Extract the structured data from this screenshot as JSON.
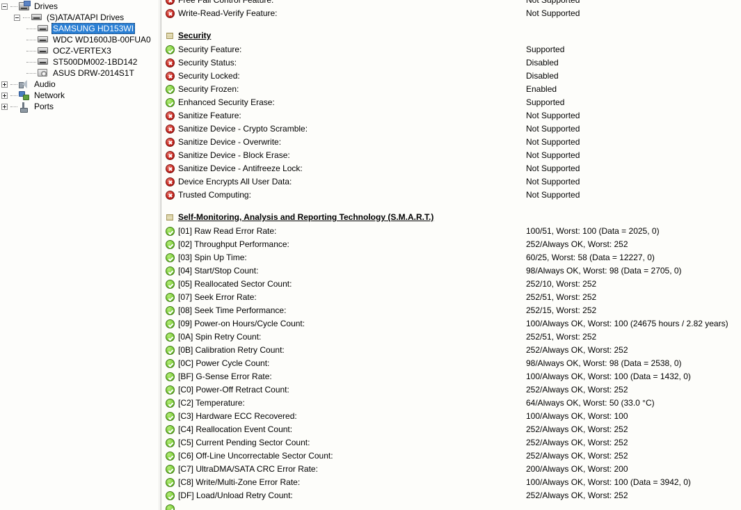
{
  "tree": {
    "nodes": [
      {
        "label": "Drives",
        "icon": "drives-icon",
        "indent": 0,
        "expander": "minus",
        "selected": false
      },
      {
        "label": "(S)ATA/ATAPI Drives",
        "icon": "hdd-icon",
        "indent": 1,
        "expander": "minus",
        "selected": false
      },
      {
        "label": "SAMSUNG HD153WI",
        "icon": "hdd-icon",
        "indent": 2,
        "expander": "none",
        "selected": true
      },
      {
        "label": "WDC WD1600JB-00FUA0",
        "icon": "hdd-icon",
        "indent": 2,
        "expander": "none",
        "selected": false
      },
      {
        "label": "OCZ-VERTEX3",
        "icon": "hdd-icon",
        "indent": 2,
        "expander": "none",
        "selected": false
      },
      {
        "label": "ST500DM002-1BD142",
        "icon": "hdd-icon",
        "indent": 2,
        "expander": "none",
        "selected": false
      },
      {
        "label": "ASUS DRW-2014S1T",
        "icon": "optical-drive-icon",
        "indent": 2,
        "expander": "none",
        "selected": false
      },
      {
        "label": "Audio",
        "icon": "audio-icon",
        "indent": 0,
        "expander": "plus",
        "selected": false
      },
      {
        "label": "Network",
        "icon": "network-icon",
        "indent": 0,
        "expander": "plus",
        "selected": false
      },
      {
        "label": "Ports",
        "icon": "ports-icon",
        "indent": 0,
        "expander": "plus",
        "selected": false
      }
    ]
  },
  "detail": {
    "rows": [
      {
        "kind": "item",
        "status": "bad",
        "label": "Free Fall Control Feature:",
        "value": "Not Supported"
      },
      {
        "kind": "item",
        "status": "bad",
        "label": "Write-Read-Verify Feature:",
        "value": "Not Supported"
      },
      {
        "kind": "spacer"
      },
      {
        "kind": "section",
        "label": "Security"
      },
      {
        "kind": "item",
        "status": "ok",
        "label": "Security Feature:",
        "value": "Supported"
      },
      {
        "kind": "item",
        "status": "bad",
        "label": "Security Status:",
        "value": "Disabled"
      },
      {
        "kind": "item",
        "status": "bad",
        "label": "Security Locked:",
        "value": "Disabled"
      },
      {
        "kind": "item",
        "status": "ok",
        "label": "Security Frozen:",
        "value": "Enabled"
      },
      {
        "kind": "item",
        "status": "ok",
        "label": "Enhanced Security Erase:",
        "value": "Supported"
      },
      {
        "kind": "item",
        "status": "bad",
        "label": "Sanitize Feature:",
        "value": "Not Supported"
      },
      {
        "kind": "item",
        "status": "bad",
        "label": "Sanitize Device - Crypto Scramble:",
        "value": "Not Supported"
      },
      {
        "kind": "item",
        "status": "bad",
        "label": "Sanitize Device - Overwrite:",
        "value": "Not Supported"
      },
      {
        "kind": "item",
        "status": "bad",
        "label": "Sanitize Device - Block Erase:",
        "value": "Not Supported"
      },
      {
        "kind": "item",
        "status": "bad",
        "label": "Sanitize Device - Antifreeze Lock:",
        "value": "Not Supported"
      },
      {
        "kind": "item",
        "status": "bad",
        "label": "Device Encrypts All User Data:",
        "value": "Not Supported"
      },
      {
        "kind": "item",
        "status": "bad",
        "label": "Trusted Computing:",
        "value": "Not Supported"
      },
      {
        "kind": "spacer"
      },
      {
        "kind": "section",
        "label": "Self-Monitoring, Analysis and Reporting Technology (S.M.A.R.T.)"
      },
      {
        "kind": "item",
        "status": "ok",
        "label": "[01] Raw Read Error Rate:",
        "value": "100/51, Worst: 100 (Data = 2025, 0)"
      },
      {
        "kind": "item",
        "status": "ok",
        "label": "[02] Throughput Performance:",
        "value": "252/Always OK, Worst: 252"
      },
      {
        "kind": "item",
        "status": "ok",
        "label": "[03] Spin Up Time:",
        "value": "60/25, Worst: 58 (Data = 12227, 0)"
      },
      {
        "kind": "item",
        "status": "ok",
        "label": "[04] Start/Stop Count:",
        "value": "98/Always OK, Worst: 98 (Data = 2705, 0)"
      },
      {
        "kind": "item",
        "status": "ok",
        "label": "[05] Reallocated Sector Count:",
        "value": "252/10, Worst: 252"
      },
      {
        "kind": "item",
        "status": "ok",
        "label": "[07] Seek Error Rate:",
        "value": "252/51, Worst: 252"
      },
      {
        "kind": "item",
        "status": "ok",
        "label": "[08] Seek Time Performance:",
        "value": "252/15, Worst: 252"
      },
      {
        "kind": "item",
        "status": "ok",
        "label": "[09] Power-on Hours/Cycle Count:",
        "value": "100/Always OK, Worst: 100 (24675 hours / 2.82 years)"
      },
      {
        "kind": "item",
        "status": "ok",
        "label": "[0A] Spin Retry Count:",
        "value": "252/51, Worst: 252"
      },
      {
        "kind": "item",
        "status": "ok",
        "label": "[0B] Calibration Retry Count:",
        "value": "252/Always OK, Worst: 252"
      },
      {
        "kind": "item",
        "status": "ok",
        "label": "[0C] Power Cycle Count:",
        "value": "98/Always OK, Worst: 98 (Data = 2538, 0)"
      },
      {
        "kind": "item",
        "status": "ok",
        "label": "[BF] G-Sense Error Rate:",
        "value": "100/Always OK, Worst: 100 (Data = 1432, 0)"
      },
      {
        "kind": "item",
        "status": "ok",
        "label": "[C0] Power-Off Retract Count:",
        "value": "252/Always OK, Worst: 252"
      },
      {
        "kind": "item",
        "status": "ok",
        "label": "[C2] Temperature:",
        "value": "64/Always OK, Worst: 50 (33.0 °C)"
      },
      {
        "kind": "item",
        "status": "ok",
        "label": "[C3] Hardware ECC Recovered:",
        "value": "100/Always OK, Worst: 100"
      },
      {
        "kind": "item",
        "status": "ok",
        "label": "[C4] Reallocation Event Count:",
        "value": "252/Always OK, Worst: 252"
      },
      {
        "kind": "item",
        "status": "ok",
        "label": "[C5] Current Pending Sector Count:",
        "value": "252/Always OK, Worst: 252"
      },
      {
        "kind": "item",
        "status": "ok",
        "label": "[C6] Off-Line Uncorrectable Sector Count:",
        "value": "252/Always OK, Worst: 252"
      },
      {
        "kind": "item",
        "status": "ok",
        "label": "[C7] UltraDMA/SATA CRC Error Rate:",
        "value": "200/Always OK, Worst: 200"
      },
      {
        "kind": "item",
        "status": "ok",
        "label": "[C8] Write/Multi-Zone Error Rate:",
        "value": "100/Always OK, Worst: 100 (Data = 3942, 0)"
      },
      {
        "kind": "item",
        "status": "ok",
        "label": "[DF] Load/Unload Retry Count:",
        "value": "252/Always OK, Worst: 252"
      },
      {
        "kind": "item",
        "status": "ok",
        "label": "",
        "value": ""
      }
    ]
  }
}
